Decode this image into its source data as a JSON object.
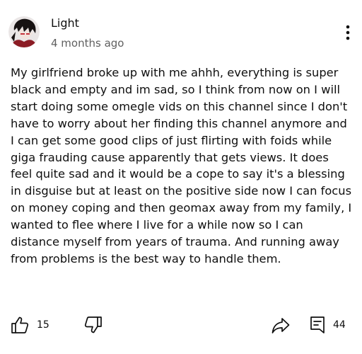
{
  "comment": {
    "author": "Light",
    "timestamp": "4 months ago",
    "text": "My girlfriend broke up with me ahhh, everything is super black and empty and im sad, so I think from now on I will start doing some omegle vids on this channel since I don't have to worry about her finding this channel anymore and I can get some good clips of just flirting with foids while giga frauding cause apparently that gets views. It does feel quite sad and it would be a cope to say it's a blessing in disguise but at least on the positive side now I can focus on money coping and then geomax away from my family, I wanted to flee where I live for a while now so I can distance myself from years of trauma. And running away from problems is the best way to handle them."
  },
  "actions": {
    "like_count": "15",
    "reply_count": "44"
  },
  "icons": {
    "avatar": "avatar-anime-character",
    "menu": "more-vertical-icon",
    "like": "thumbs-up-icon",
    "dislike": "thumbs-down-icon",
    "share": "share-arrow-icon",
    "replies": "reply-comment-icon"
  },
  "colors": {
    "text": "#0f0f0f",
    "secondary_text": "#606060"
  }
}
